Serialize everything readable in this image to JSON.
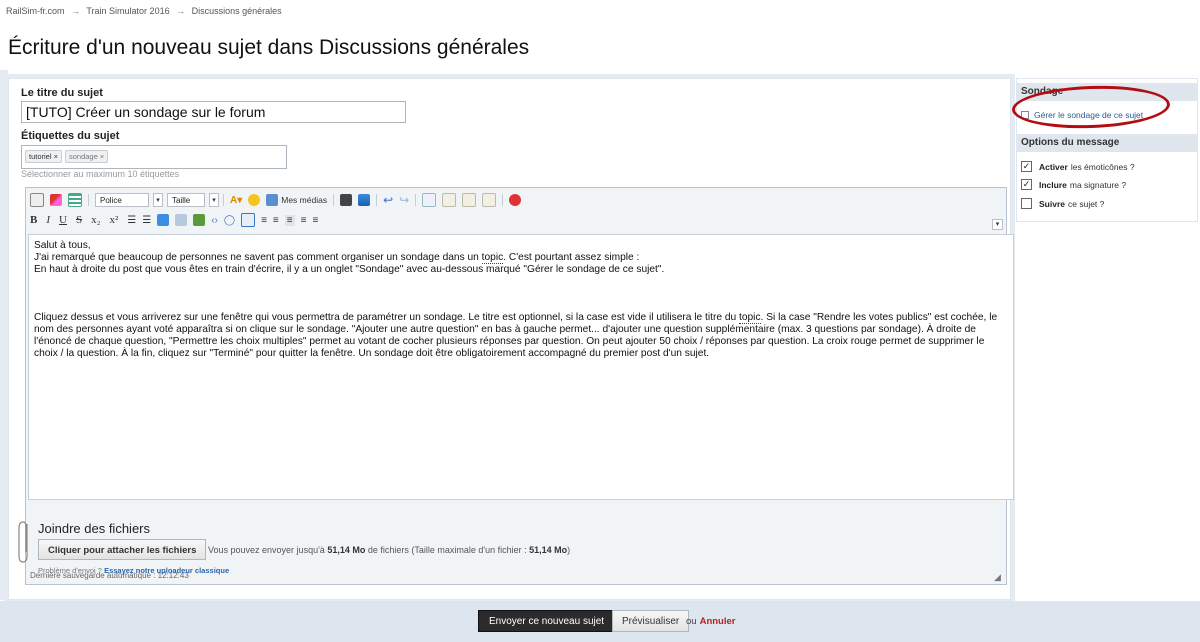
{
  "breadcrumb": {
    "items": [
      "RailSim-fr.com",
      "Train Simulator 2016",
      "Discussions générales"
    ],
    "separator": "→"
  },
  "page_title": "Écriture d'un nouveau sujet dans Discussions générales",
  "form": {
    "title_label": "Le titre du sujet",
    "title_value": "[TUTO] Créer un sondage sur le forum",
    "tags_label": "Étiquettes du sujet",
    "tags": [
      "tutoriel ×",
      "sondage ×"
    ],
    "tags_hint": "Sélectionner au maximum 10 étiquettes"
  },
  "editor": {
    "font_select": "Police",
    "size_select": "Taille",
    "media_label": "Mes médias",
    "toolbar_row2": [
      "B",
      "I",
      "U",
      "S",
      "x₂",
      "x²"
    ],
    "content": {
      "line1": "Salut à tous,",
      "line2a": "J'ai remarqué que beaucoup de personnes ne savent pas comment organiser un sondage dans un ",
      "line2_word": "topic",
      "line2b": ". C'est pourtant assez simple :",
      "line3": "En haut à droite du post que vous êtes en train d'écrire, il y a un onglet \"Sondage\" avec au-dessous marqué \"Gérer le sondage de ce sujet\".",
      "para2a": "Cliquez dessus et vous arriverez sur une fenêtre qui vous permettra de paramétrer un sondage. Le titre est optionnel, si la case est vide il utilisera le titre du ",
      "para2_word": "topic",
      "para2b": ". Si la case \"Rendre les votes publics\" est cochée, le nom des personnes ayant voté apparaîtra si on clique sur le sondage. \"Ajouter une autre question\" en bas à gauche permet... d'ajouter une question supplémentaire (max. 3 questions par sondage). À droite de l'énoncé de chaque question, \"Permettre les choix multiples\" permet au votant de cocher plusieurs réponses par question. On peut ajouter 50 choix / réponses par question. La croix rouge permet de supprimer le choix / la question. À la fin, cliquez sur \"Terminé\" pour quitter la fenêtre. Un sondage doit être obligatoirement accompagné du premier post d'un sujet."
    },
    "autosave_status": "Dernière sauvegarde automatique : 12:12:43"
  },
  "attachments": {
    "title": "Joindre des fichiers",
    "button": "Cliquer pour attacher les fichiers",
    "info_prefix": "Vous pouvez envoyer jusqu'à ",
    "info_total": "51,14 Mo",
    "info_middle": " de fichiers (Taille maximale d'un fichier : ",
    "info_max": "51,14 Mo",
    "info_suffix": ")",
    "problem_text": "Problème d'envoi ? ",
    "problem_link": "Essayez notre uploadeur classique"
  },
  "sidebar": {
    "poll_heading": "Sondage",
    "poll_link": "Gérer le sondage de ce sujet",
    "options_heading": "Options du message",
    "options": [
      {
        "bold": "Activer",
        "rest": "les émoticônes ?",
        "checked": true
      },
      {
        "bold": "Inclure",
        "rest": "ma signature ?",
        "checked": true
      },
      {
        "bold": "Suivre",
        "rest": "ce sujet ?",
        "checked": false
      }
    ]
  },
  "actions": {
    "submit": "Envoyer ce nouveau sujet",
    "preview": "Prévisualiser",
    "or": "ou",
    "cancel": "Annuler"
  },
  "colors": {
    "annotation": "#b30d12",
    "link": "#2a5a8e",
    "cancel": "#b52222",
    "frame": "#e4ebf3"
  }
}
